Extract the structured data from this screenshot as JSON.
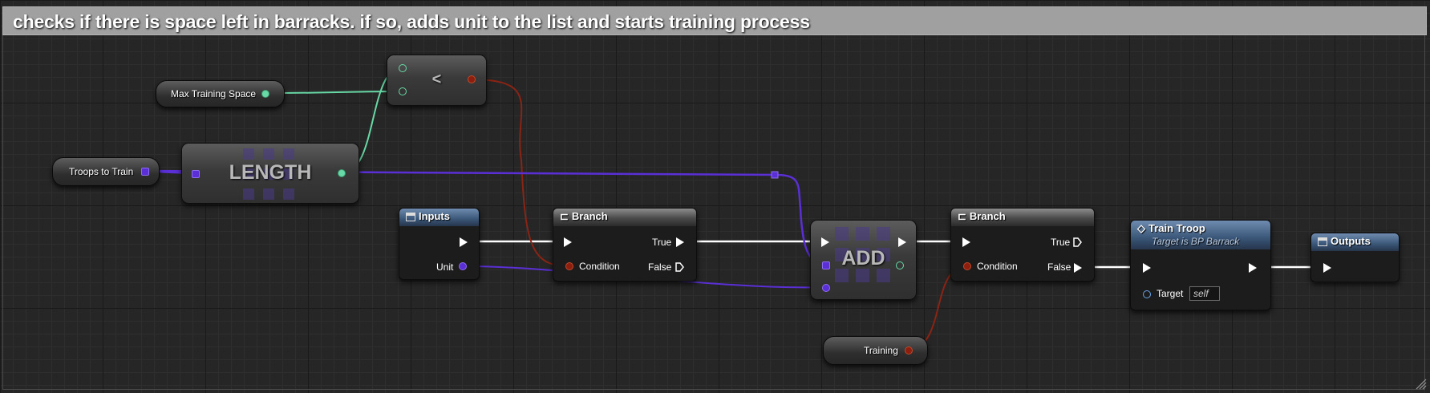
{
  "comment": "checks if there is space left in barracks. if so, adds unit to the list and starts training process",
  "nodes": {
    "max_training_space": {
      "label": "Max Training Space"
    },
    "less_than": {
      "operator": "<"
    },
    "troops_to_train": {
      "label": "Troops to Train"
    },
    "length": {
      "title": "LENGTH"
    },
    "inputs": {
      "title": "Inputs",
      "unit_pin": "Unit"
    },
    "branch1": {
      "title": "Branch",
      "true_pin": "True",
      "false_pin": "False",
      "condition_pin": "Condition"
    },
    "add": {
      "title": "ADD"
    },
    "branch2": {
      "title": "Branch",
      "true_pin": "True",
      "false_pin": "False",
      "condition_pin": "Condition"
    },
    "train_troop": {
      "title": "Train Troop",
      "subtitle": "Target is BP Barrack",
      "target_pin": "Target",
      "target_value": "self"
    },
    "outputs": {
      "title": "Outputs"
    },
    "training": {
      "label": "Training"
    }
  },
  "colors": {
    "float_pin": "#68d9a6",
    "bool_pin": "#8c1f10",
    "object_pin": "#5a2fd6",
    "exec_wire": "#ffffff",
    "function_header": "#3a5678",
    "comment_bar": "#a0a0a0"
  }
}
